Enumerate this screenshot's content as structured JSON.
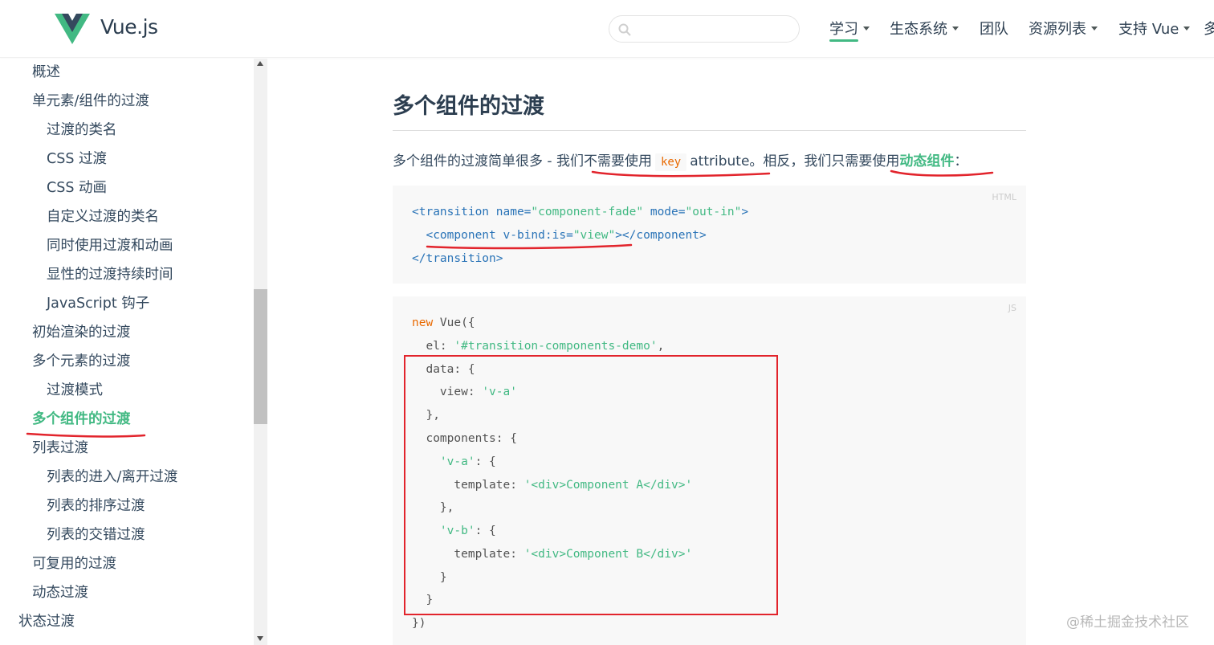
{
  "header": {
    "brand": "Vue.js",
    "search_placeholder": "",
    "nav": [
      {
        "label": "学习",
        "dropdown": true
      },
      {
        "label": "生态系统",
        "dropdown": true
      },
      {
        "label": "团队",
        "dropdown": false
      },
      {
        "label": "资源列表",
        "dropdown": true
      },
      {
        "label": "支持 Vue",
        "dropdown": true
      },
      {
        "label": "多",
        "dropdown": false
      }
    ]
  },
  "sidebar": {
    "items": [
      {
        "label": "概述",
        "level": 1
      },
      {
        "label": "单元素/组件的过渡",
        "level": 1
      },
      {
        "label": "过渡的类名",
        "level": 2
      },
      {
        "label": "CSS 过渡",
        "level": 2
      },
      {
        "label": "CSS 动画",
        "level": 2
      },
      {
        "label": "自定义过渡的类名",
        "level": 2
      },
      {
        "label": "同时使用过渡和动画",
        "level": 2
      },
      {
        "label": "显性的过渡持续时间",
        "level": 2
      },
      {
        "label": "JavaScript 钩子",
        "level": 2
      },
      {
        "label": "初始渲染的过渡",
        "level": 1
      },
      {
        "label": "多个元素的过渡",
        "level": 1
      },
      {
        "label": "过渡模式",
        "level": 2
      },
      {
        "label": "多个组件的过渡",
        "level": 1,
        "active": true
      },
      {
        "label": "列表过渡",
        "level": 1
      },
      {
        "label": "列表的进入/离开过渡",
        "level": 2
      },
      {
        "label": "列表的排序过渡",
        "level": 2
      },
      {
        "label": "列表的交错过渡",
        "level": 2
      },
      {
        "label": "可复用的过渡",
        "level": 1
      },
      {
        "label": "动态过渡",
        "level": 1
      },
      {
        "label": "状态过渡",
        "level": 0
      }
    ]
  },
  "content": {
    "heading": "多个组件的过渡",
    "para_before": "多个组件的过渡简单很多 - 我们不需要使用",
    "para_code": "key",
    "para_mid": "attribute。相反，我们只需要使用",
    "para_link": "动态组件",
    "para_end": "：",
    "html_lang": "HTML",
    "js_lang": "JS"
  },
  "html_code": {
    "l1_open": "<transition ",
    "l1_attr1": "name=",
    "l1_val1": "\"component-fade\"",
    "l1_attr2": " mode=",
    "l1_val2": "\"out-in\"",
    "l1_close": ">",
    "l2_open": "  <component ",
    "l2_attr": "v-bind:is=",
    "l2_val": "\"view\"",
    "l2_close": "></component>",
    "l3": "</transition>"
  },
  "js_code": {
    "new": "new",
    "vue": " Vue({",
    "el_key": "  el: ",
    "el_val": "'#transition-components-demo'",
    "el_comma": ",",
    "data_open": "  data: {",
    "view_key": "    view: ",
    "view_val": "'v-a'",
    "data_close": "  },",
    "comp_open": "  components: {",
    "va_indent": "    ",
    "va_key": "'v-a'",
    "va_open": ": {",
    "tmpl_key": "      template: ",
    "tmpl_a": "'<div>Component A</div>'",
    "va_close": "    },",
    "vb_key": "'v-b'",
    "tmpl_b": "'<div>Component B</div>'",
    "vb_close": "    }",
    "comp_close": "  }",
    "end": "})"
  },
  "watermark": "@稀土掘金技术社区",
  "colors": {
    "accent": "#42b983",
    "annotation_red": "#e2242c",
    "text": "#34495e",
    "code_keyword": "#e96900",
    "code_tag": "#2973b7"
  }
}
